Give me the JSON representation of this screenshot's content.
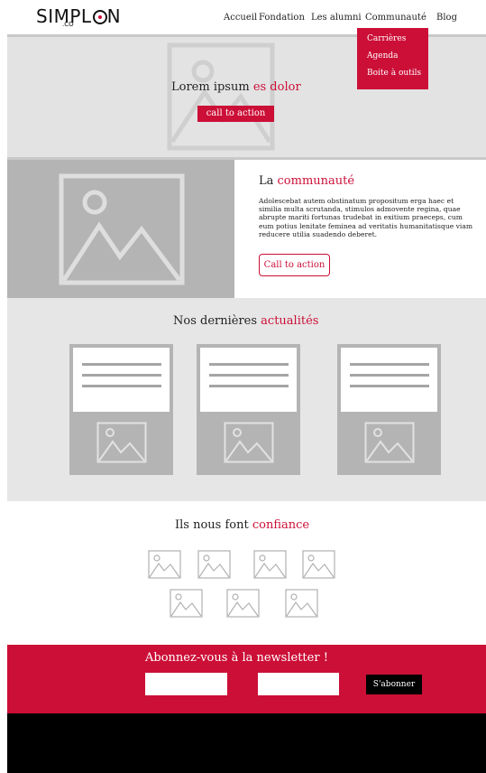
{
  "header": {
    "logo_text": "SIMPL",
    "logo_end": "N",
    "logo_sub": ".CO",
    "nav": [
      "Accueil",
      "Fondation",
      "Les alumni",
      "Communauté",
      "Blog"
    ],
    "dropdown": [
      "Carrières",
      "Agenda",
      "Boite à outils"
    ]
  },
  "hero": {
    "title_plain": "Lorem ipsum ",
    "title_accent": "es dolor",
    "cta": "call to action"
  },
  "community": {
    "title_plain": "La ",
    "title_accent": "communauté",
    "text": "Adolescebat autem obstinatum propositum erga haec et similia multa scrutanda, stimulos admovente regina, quae abrupte mariti fortunas trudebat in exitium praeceps, cum eum potius lenitate feminea ad veritatis humanitatisque viam reducere utilia suadendo deberet.",
    "cta": "Call to action"
  },
  "news": {
    "title_plain": "Nos dernières ",
    "title_accent": "actualités"
  },
  "trust": {
    "title_plain": "Ils nous font ",
    "title_accent": "confiance"
  },
  "newsletter": {
    "title": "Abonnez-vous à la newsletter !",
    "input1_value": "",
    "input2_value": "",
    "button": "S'abonner"
  },
  "colors": {
    "accent": "#cc0f37",
    "placeholder_gray": "#b4b4b4",
    "section_gray": "#e6e6e6",
    "footer": "#000000"
  },
  "icons": [
    "image-placeholder-icon"
  ]
}
